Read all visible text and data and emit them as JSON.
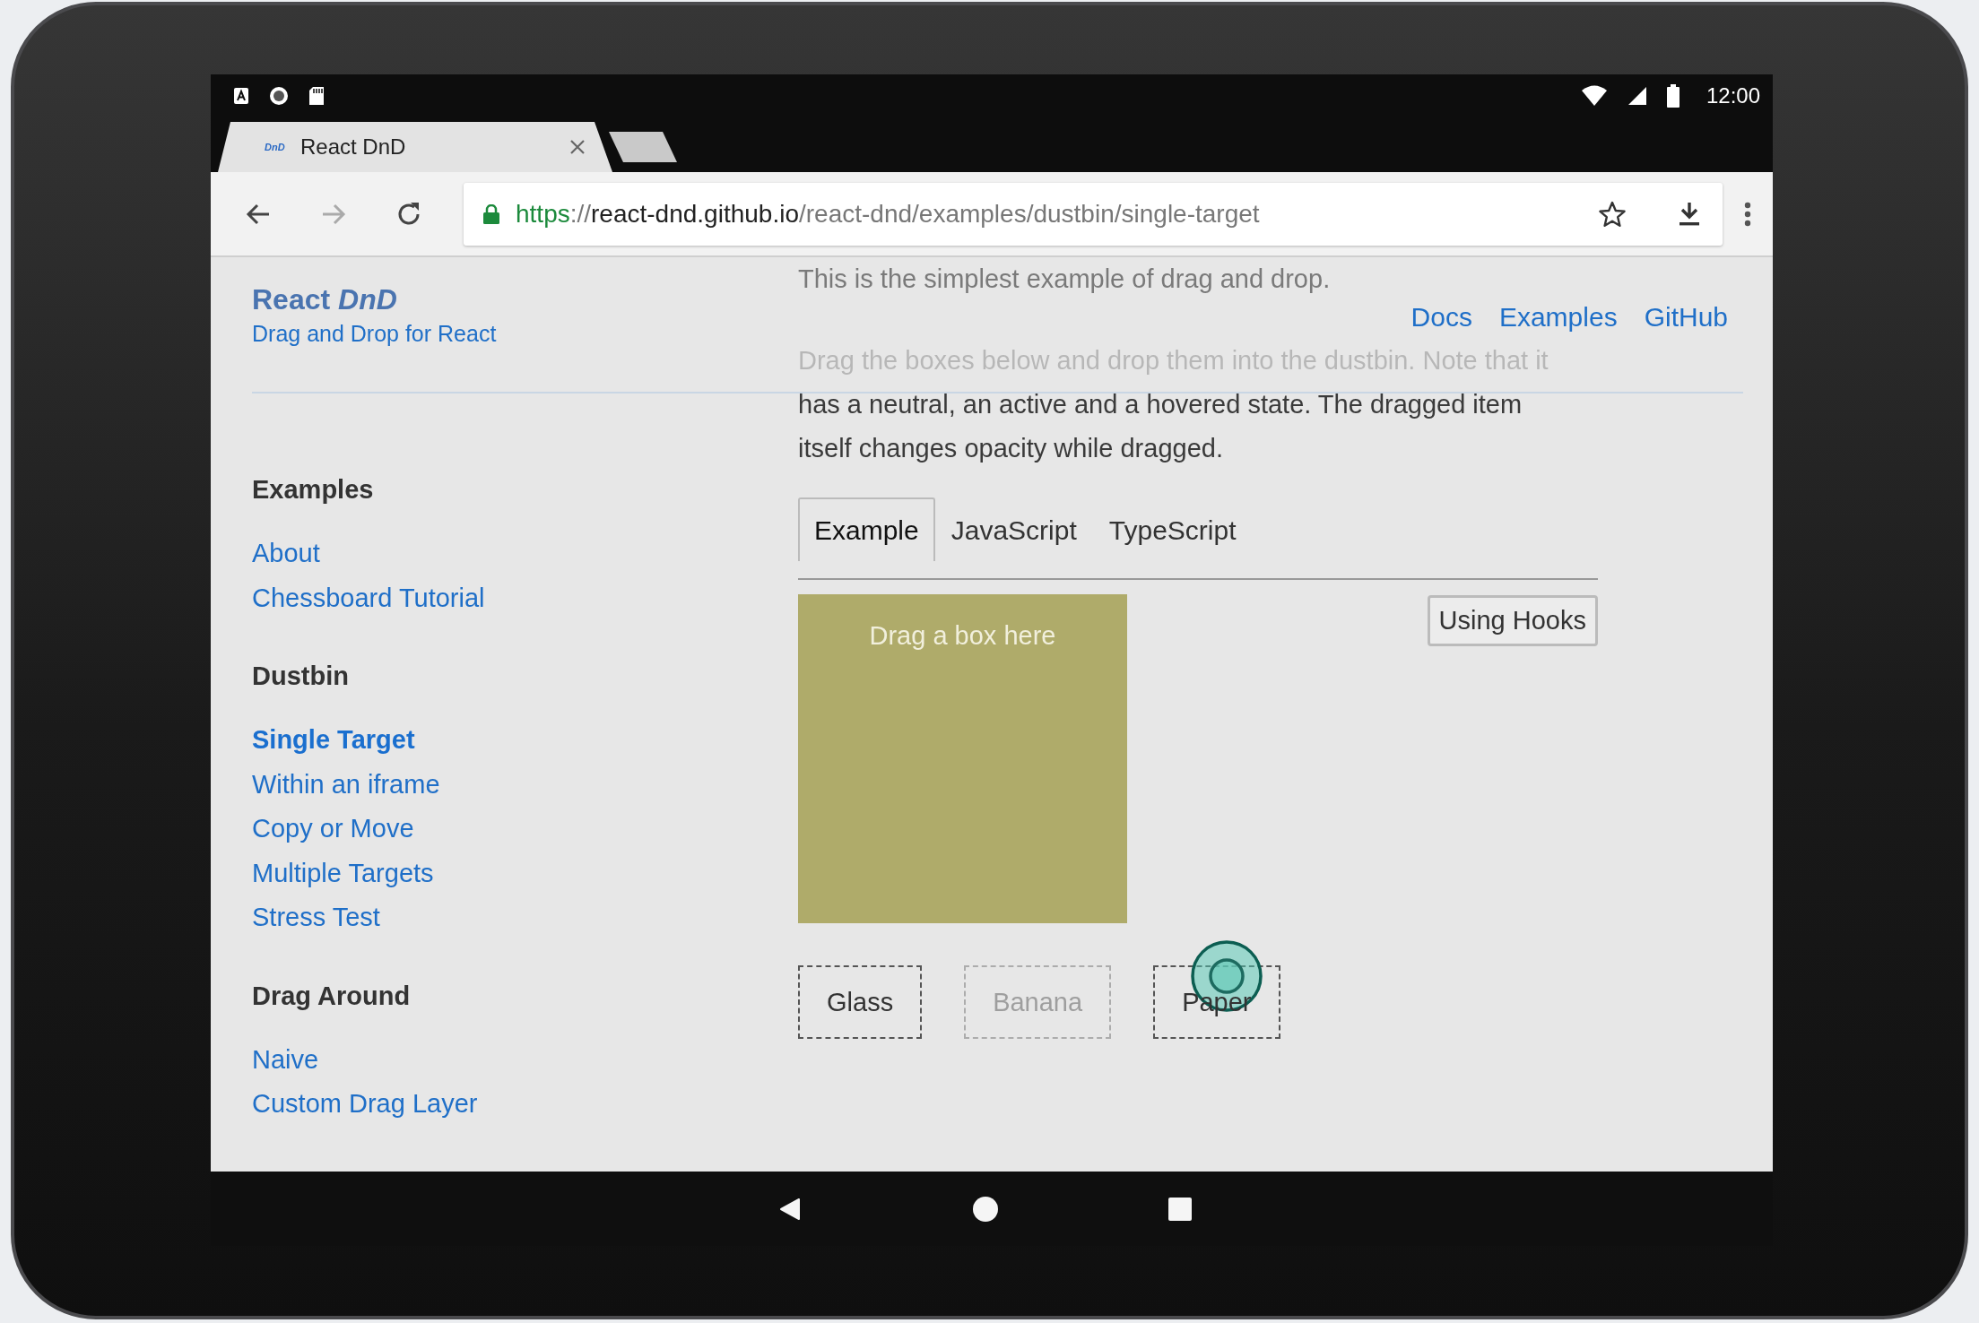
{
  "status_bar": {
    "time": "12:00"
  },
  "browser": {
    "tab": {
      "title": "React DnD",
      "favicon": "DnD"
    },
    "address": {
      "scheme": "https",
      "separator": "://",
      "host": "react-dnd.github.io",
      "path": "/react-dnd/examples/dustbin/single-target"
    }
  },
  "site": {
    "brand": "React *DnD*",
    "tagline": "Drag and Drop for React",
    "nav": [
      "Docs",
      "Examples",
      "GitHub"
    ],
    "sidebar": [
      {
        "heading": "Examples",
        "items": [
          {
            "label": "About",
            "selected": false
          },
          {
            "label": "Chessboard Tutorial",
            "selected": false
          }
        ]
      },
      {
        "heading": "Dustbin",
        "items": [
          {
            "label": "Single Target",
            "selected": true
          },
          {
            "label": "Within an iframe",
            "selected": false
          },
          {
            "label": "Copy or Move",
            "selected": false
          },
          {
            "label": "Multiple Targets",
            "selected": false
          },
          {
            "label": "Stress Test",
            "selected": false
          }
        ]
      },
      {
        "heading": "Drag Around",
        "items": [
          {
            "label": "Naive",
            "selected": false
          },
          {
            "label": "Custom Drag Layer",
            "selected": false
          }
        ]
      }
    ],
    "intro": "This is the simplest example of drag and drop.",
    "description": "Drag the boxes below and drop them into the dustbin. Note that it has a neutral, an active and a hovered state. The dragged item itself changes opacity while dragged.",
    "tabs": [
      {
        "label": "Example",
        "selected": true
      },
      {
        "label": "JavaScript",
        "selected": false
      },
      {
        "label": "TypeScript",
        "selected": false
      }
    ],
    "hooks_button": "Using Hooks",
    "dustbin": {
      "label": "Drag a box here"
    },
    "boxes": [
      {
        "label": "Glass",
        "dragging": false,
        "touched": false
      },
      {
        "label": "Banana",
        "dragging": true,
        "touched": false
      },
      {
        "label": "Paper",
        "dragging": false,
        "touched": true
      }
    ]
  }
}
